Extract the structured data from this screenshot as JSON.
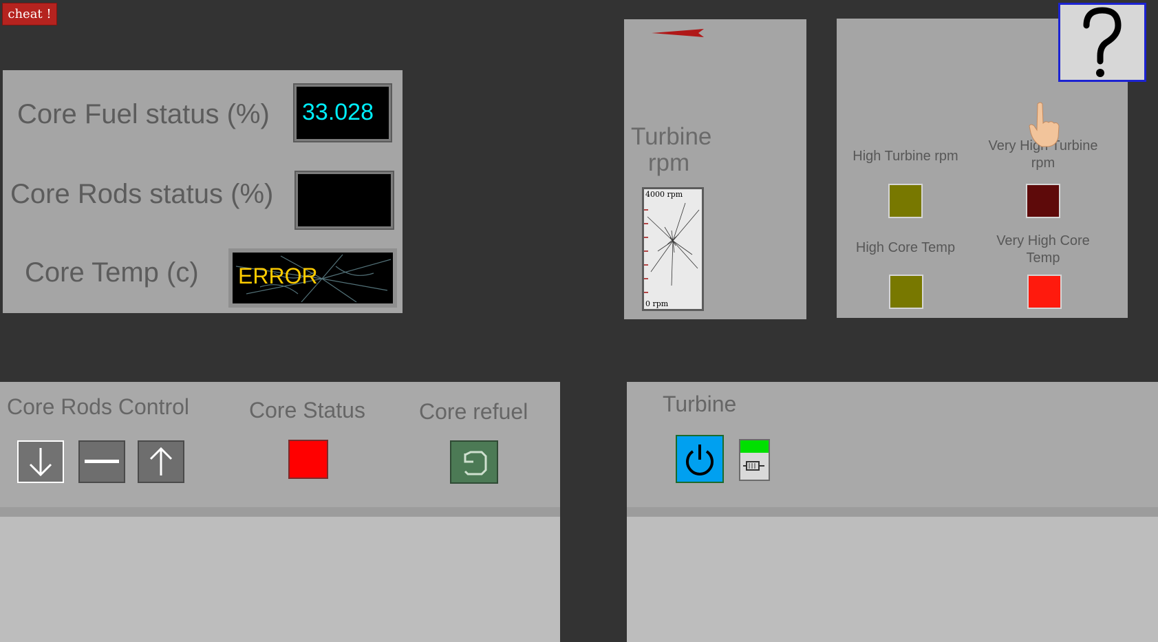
{
  "cheat": {
    "label": "cheat !"
  },
  "help": {
    "label": "?"
  },
  "core_panel": {
    "fuel_label": "Core Fuel status (%)",
    "fuel_value": "33.028",
    "rods_label": "Core Rods status (%)",
    "rods_value": "",
    "temp_label": "Core Temp (c)",
    "temp_value": "ERROR"
  },
  "rpm_panel": {
    "title": "Turbine rpm",
    "gauge_max": "4000 rpm",
    "gauge_min": "0 rpm"
  },
  "alarms": {
    "high_turbine_rpm": "High Turbine rpm",
    "very_high_turbine_rpm": "Very High Turbine rpm",
    "high_core_temp": "High Core Temp",
    "very_high_core_temp": "Very High Core Temp",
    "colors": {
      "high_turbine_rpm": "#787800",
      "very_high_turbine_rpm": "#5e0a0a",
      "high_core_temp": "#787800",
      "very_high_core_temp": "#ff1a0d"
    }
  },
  "core_controls": {
    "rods_title": "Core Rods Control",
    "status_title": "Core Status",
    "refuel_title": "Core refuel",
    "status_color": "#ff0000",
    "icons": [
      "arrow-down-icon",
      "minus-icon",
      "arrow-up-icon",
      "refresh-icon"
    ]
  },
  "turbine_controls": {
    "title": "Turbine",
    "power_color": "#00a0f0",
    "generator_indicator_color": "#00e000",
    "icons": [
      "power-icon",
      "generator-icon"
    ]
  }
}
